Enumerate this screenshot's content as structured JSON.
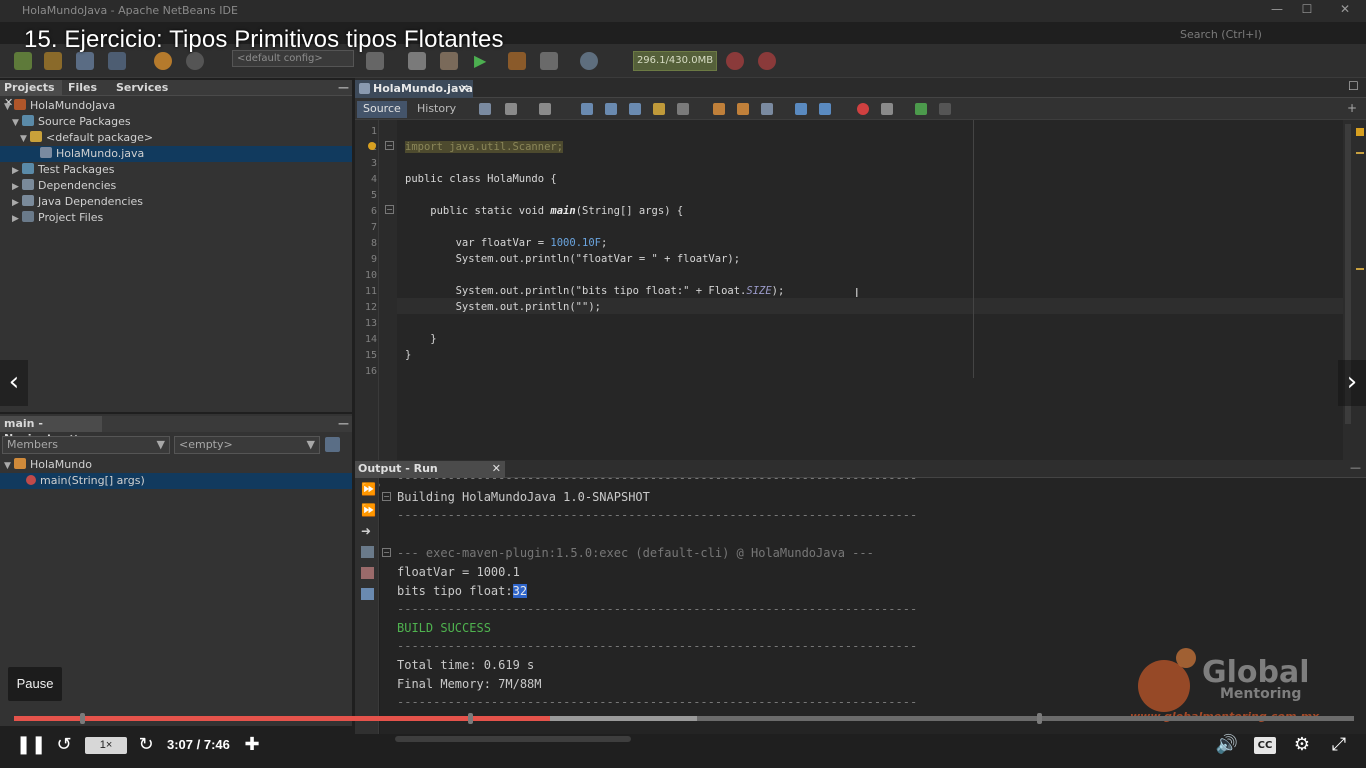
{
  "window": {
    "title": "HolaMundoJava - Apache NetBeans IDE",
    "minimize": "—",
    "maximize": "☐",
    "close": "✕"
  },
  "video": {
    "title": "15. Ejercicio: Tipos Primitivos tipos Flotantes",
    "pause_tooltip": "Pause",
    "speed": "1×",
    "time_current": "3:07",
    "time_total": "7:46",
    "time_display": "3:07 / 7:46",
    "progress_played": 0.4,
    "progress_buffered": 0.51,
    "cc_label": "CC"
  },
  "toolbar": {
    "config": "<default config>",
    "memory": "296.1/430.0MB",
    "search_placeholder": "Search (Ctrl+I)"
  },
  "projects_panel": {
    "tabs": [
      "Projects",
      "Files",
      "Services"
    ],
    "tree": [
      {
        "label": "HolaMundoJava",
        "level": 0,
        "expanded": true
      },
      {
        "label": "Source Packages",
        "level": 1,
        "expanded": true
      },
      {
        "label": "<default package>",
        "level": 2,
        "expanded": true
      },
      {
        "label": "HolaMundo.java",
        "level": 3,
        "selected": true
      },
      {
        "label": "Test Packages",
        "level": 1
      },
      {
        "label": "Dependencies",
        "level": 1
      },
      {
        "label": "Java Dependencies",
        "level": 1
      },
      {
        "label": "Project Files",
        "level": 1
      }
    ]
  },
  "navigator": {
    "tab": "main - Navigator",
    "members_combo": "Members",
    "filter_combo": "<empty>",
    "tree": [
      {
        "label": "HolaMundo",
        "level": 0
      },
      {
        "label": "main(String[] args)",
        "level": 1,
        "selected": true
      }
    ]
  },
  "editor": {
    "tab": "HolaMundo.java",
    "source_tab": "Source",
    "history_tab": "History",
    "lines": [
      "",
      "import java.util.Scanner;",
      "",
      "public class HolaMundo {",
      "",
      "    public static void main(String[] args) {",
      "",
      "        var floatVar = 1000.10F;",
      "        System.out.println(\"floatVar = \" + floatVar);",
      "",
      "        System.out.println(\"bits tipo float:\" + Float.SIZE);",
      "        System.out.println(\"\");",
      "",
      "    }",
      "}",
      ""
    ]
  },
  "output": {
    "tab": "Output - Run (HolaMund...",
    "lines": [
      "------------------------------------------------------------------------",
      "Building HolaMundoJava 1.0-SNAPSHOT",
      "------------------------------------------------------------------------",
      "",
      "--- exec-maven-plugin:1.5.0:exec (default-cli) @ HolaMundoJava ---",
      "floatVar = 1000.1",
      "bits tipo float:32",
      "------------------------------------------------------------------------",
      "BUILD SUCCESS",
      "------------------------------------------------------------------------",
      "Total time: 0.619 s",
      "Final Memory: 7M/88M",
      "------------------------------------------------------------------------"
    ]
  },
  "watermark": {
    "brand_top": "Global",
    "brand_bottom": "Mentoring",
    "url": "www.globalmentoring.com.mx"
  },
  "colors": {
    "accent_progress": "#e5534b",
    "build_success": "#4fb34f",
    "selection": "#113a5e"
  }
}
